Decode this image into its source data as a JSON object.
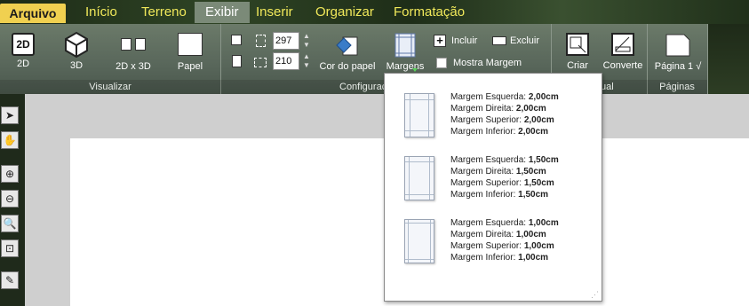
{
  "menu": {
    "file": "Arquivo",
    "tabs": [
      "Início",
      "Terreno",
      "Exibir",
      "Inserir",
      "Organizar",
      "Formatação"
    ]
  },
  "ribbon": {
    "visualizar": {
      "label": "Visualizar",
      "btn_2d": "2D",
      "btn_2d_icon": "2D",
      "btn_3d": "3D",
      "btn_2d3d": "2D x 3D",
      "btn_papel": "Papel"
    },
    "configuracoes": {
      "label": "Configuraç",
      "width_value": "297",
      "height_value": "210",
      "cor_papel": "Cor do papel",
      "margens": "Margens",
      "incluir": "Incluir",
      "excluir": "Excluir",
      "mostra_margem": "Mostra Margem"
    },
    "group3": {
      "label": "ual",
      "criar": "Criar",
      "converte": "Converte"
    },
    "paginas": {
      "label": "Páginas",
      "pagina": "Página 1 √"
    }
  },
  "margins_menu": [
    {
      "esq_label": "Margem Esquerda: ",
      "esq": "2,00cm",
      "dir_label": "Margem Direita: ",
      "dir": "2,00cm",
      "sup_label": "Margem Superior: ",
      "sup": "2,00cm",
      "inf_label": "Margem Inferior: ",
      "inf": "2,00cm"
    },
    {
      "esq_label": "Margem Esquerda: ",
      "esq": "1,50cm",
      "dir_label": "Margem Direita: ",
      "dir": "1,50cm",
      "sup_label": "Margem Superior: ",
      "sup": "1,50cm",
      "inf_label": "Margem Inferior: ",
      "inf": "1,50cm"
    },
    {
      "esq_label": "Margem Esquerda: ",
      "esq": "1,00cm",
      "dir_label": "Margem Direita: ",
      "dir": "1,00cm",
      "sup_label": "Margem Superior: ",
      "sup": "1,00cm",
      "inf_label": "Margem Inferior: ",
      "inf": "1,00cm"
    }
  ],
  "icons": {
    "cursor": "arrow-cursor-icon",
    "hand": "hand-icon",
    "zoom_in": "zoom-in-icon",
    "zoom_out": "zoom-out-icon",
    "zoom": "zoom-icon",
    "zoom_fit": "zoom-fit-icon",
    "measure": "measure-icon"
  },
  "colors": {
    "file_tab": "#f0d050",
    "menu_text": "#f0e85a",
    "active_tab": "#7b8a78",
    "ribbon": "#5b695c"
  }
}
